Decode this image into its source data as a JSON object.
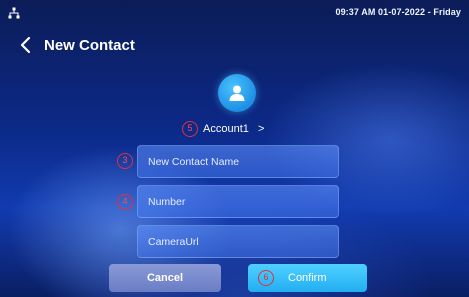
{
  "status_bar": {
    "network_icon": "network-icon",
    "datetime": "09:37 AM  01-07-2022 - Friday"
  },
  "header": {
    "back_icon": "chevron-left-icon",
    "title": "New Contact"
  },
  "avatar": {
    "icon": "person-icon",
    "color": "#2a9df0"
  },
  "account": {
    "step": "5",
    "label": "Account1",
    "chevron": ">"
  },
  "fields": [
    {
      "step": "3",
      "placeholder": "New Contact Name",
      "value": ""
    },
    {
      "step": "4",
      "placeholder": "Number",
      "value": ""
    },
    {
      "placeholder": "CameraUrl",
      "value": ""
    }
  ],
  "buttons": {
    "cancel_label": "Cancel",
    "confirm_step": "6",
    "confirm_label": "Confirm"
  },
  "colors": {
    "badge": "#e0303a",
    "confirm": "#2cb8f5",
    "cancel": "#7b8bcd"
  }
}
